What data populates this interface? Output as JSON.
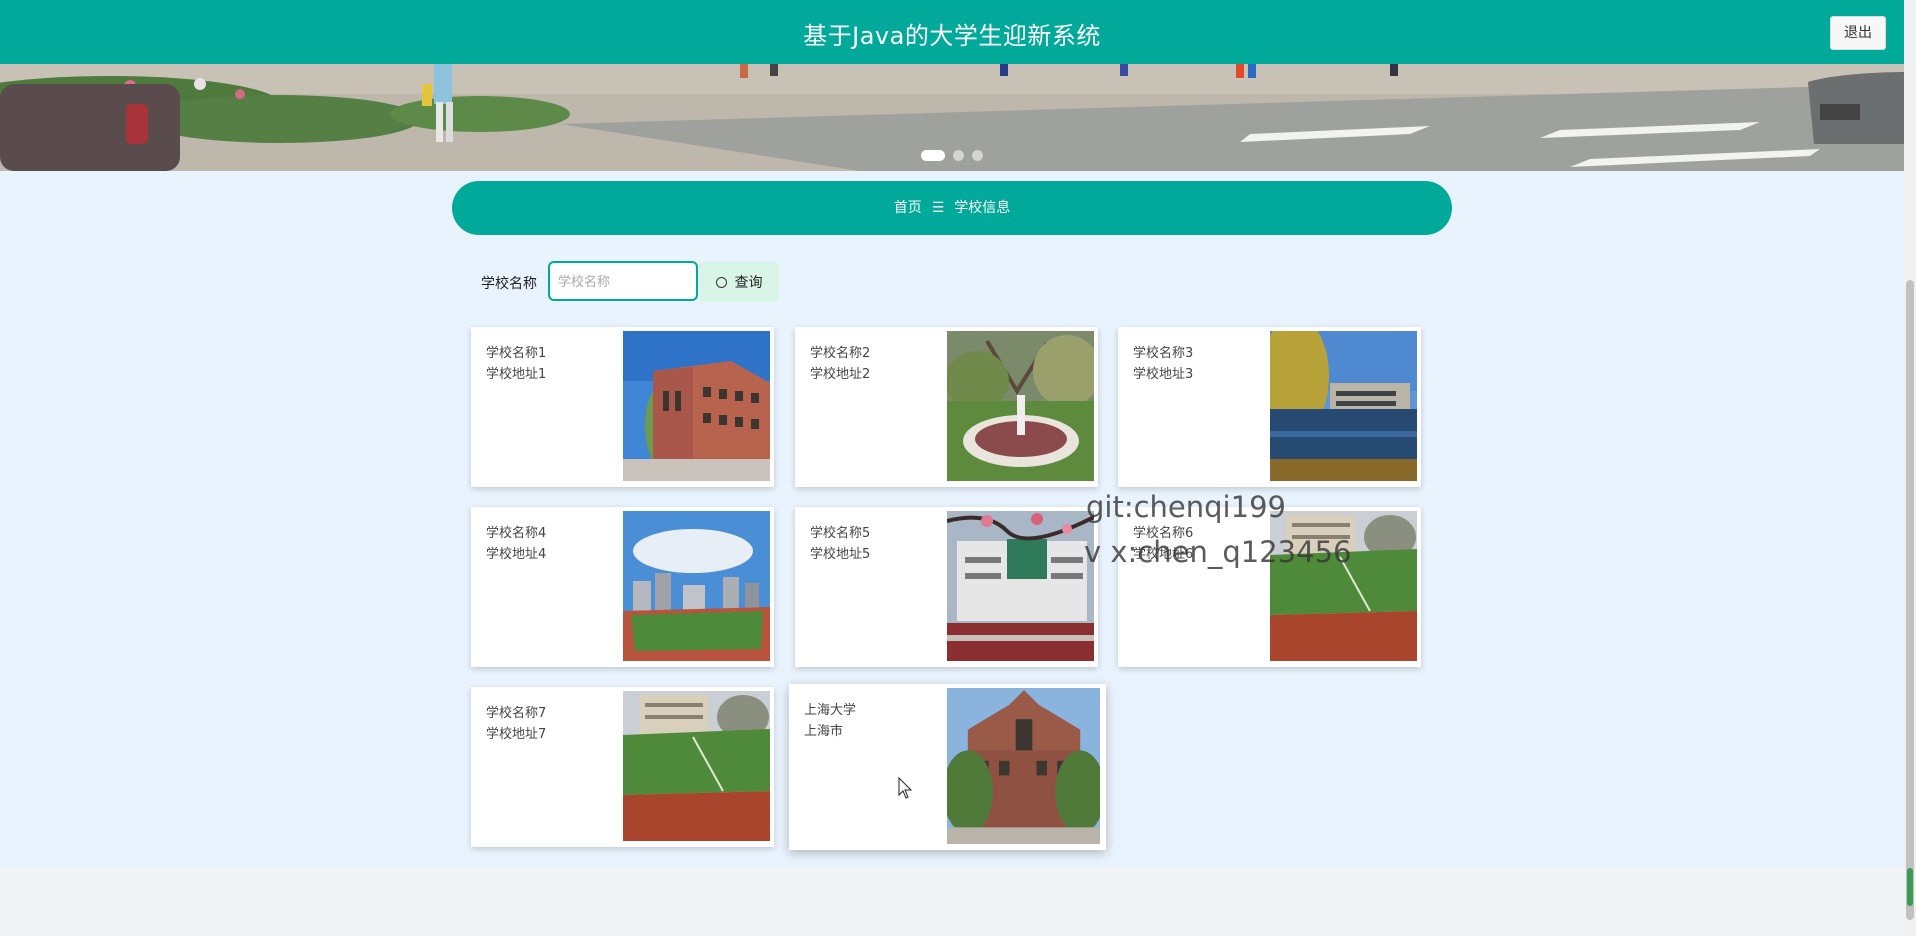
{
  "header": {
    "title": "基于Java的大学生迎新系统",
    "logout_label": "退出"
  },
  "banner": {
    "slide_count": 3,
    "active_index": 0
  },
  "breadcrumb": {
    "home": "首页",
    "separator": "☰",
    "current": "学校信息"
  },
  "search": {
    "label": "学校名称",
    "placeholder": "学校名称",
    "value": "",
    "button_label": "查询"
  },
  "schools": [
    {
      "name": "学校名称1",
      "address": "学校地址1",
      "image": "brick-building"
    },
    {
      "name": "学校名称2",
      "address": "学校地址2",
      "image": "garden-fountain"
    },
    {
      "name": "学校名称3",
      "address": "学校地址3",
      "image": "lake-campus"
    },
    {
      "name": "学校名称4",
      "address": "学校地址4",
      "image": "sports-field-city"
    },
    {
      "name": "学校名称5",
      "address": "学校地址5",
      "image": "building-blossom"
    },
    {
      "name": "学校名称6",
      "address": "学校地址6",
      "image": "running-track"
    },
    {
      "name": "学校名称7",
      "address": "学校地址7",
      "image": "running-track"
    },
    {
      "name": "上海大学",
      "address": "上海市",
      "image": "historic-building"
    }
  ],
  "watermark": {
    "line1": "git:chenqi199",
    "line2": "v x:chen_q123456"
  },
  "colors": {
    "primary": "#00a99a",
    "content_bg": "#e9f3fd",
    "search_button_bg": "#d8f5e7"
  }
}
